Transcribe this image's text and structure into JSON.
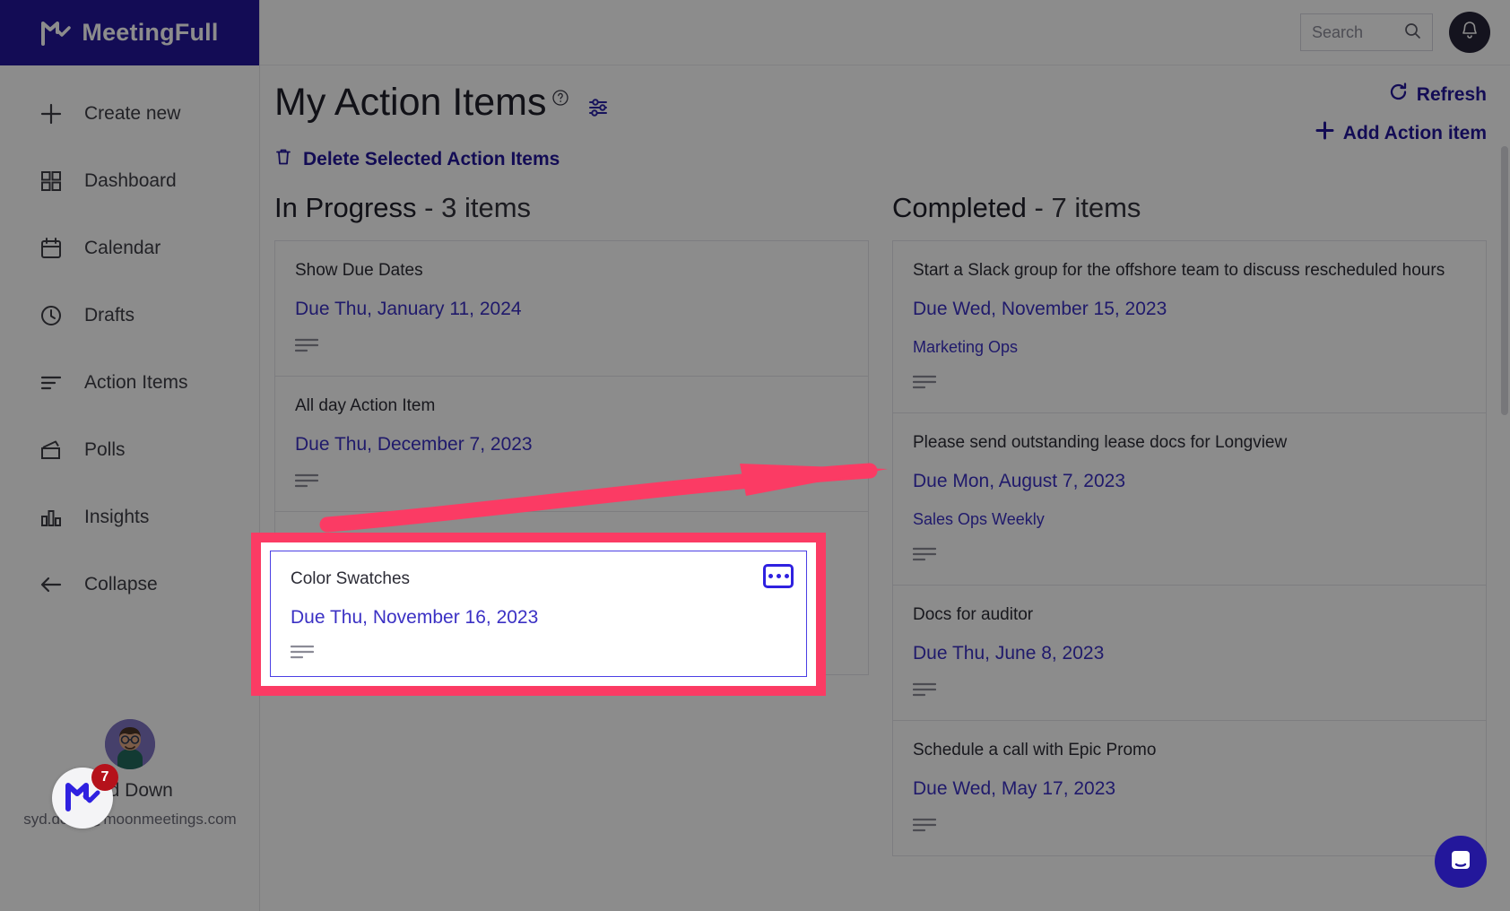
{
  "brand": {
    "name": "MeetingFull",
    "logo_icon": "meetingfull-logo-icon",
    "bg_color": "#23179b"
  },
  "sidebar": {
    "items": [
      {
        "label": "Create new",
        "icon": "plus-icon"
      },
      {
        "label": "Dashboard",
        "icon": "grid-icon"
      },
      {
        "label": "Calendar",
        "icon": "calendar-icon"
      },
      {
        "label": "Drafts",
        "icon": "clock-icon"
      },
      {
        "label": "Action Items",
        "icon": "list-lines-icon"
      },
      {
        "label": "Polls",
        "icon": "polls-icon"
      },
      {
        "label": "Insights",
        "icon": "bar-chart-icon"
      },
      {
        "label": "Collapse",
        "icon": "arrow-left-icon"
      }
    ],
    "user": {
      "name": "Syd Down",
      "email": "syd.down@moonmeetings.com",
      "avatar_icon": "user-avatar"
    }
  },
  "topbar": {
    "search": {
      "placeholder": "Search",
      "value": "",
      "icon": "search-icon"
    },
    "notifications_icon": "bell-icon"
  },
  "header": {
    "title": "My Action Items",
    "help_icon": "question-circle-icon",
    "filter_icon": "sliders-icon",
    "refresh_label": "Refresh",
    "refresh_icon": "refresh-icon",
    "add_label": "Add Action item",
    "add_icon": "plus-icon"
  },
  "toolbar": {
    "delete_label": "Delete Selected Action Items",
    "delete_icon": "trash-icon"
  },
  "columns": [
    {
      "name": "In Progress",
      "separator": "-",
      "count_label": "3 items",
      "cards": [
        {
          "title": "Show Due Dates",
          "due": "Due Thu, January 11, 2024",
          "meeting": "",
          "notes_icon": "notes-lines-icon"
        },
        {
          "title": "All day Action Item",
          "due": "Due Thu, December 7, 2023",
          "meeting": "",
          "notes_icon": "notes-lines-icon"
        }
      ]
    },
    {
      "name": "Completed",
      "separator": "-",
      "count_label": "7 items",
      "cards": [
        {
          "title": "Start a Slack group for the offshore team to discuss rescheduled hours",
          "due": "Due Wed, November 15, 2023",
          "meeting": "Marketing Ops",
          "notes_icon": "notes-lines-icon"
        },
        {
          "title": "Please send outstanding lease docs for Longview",
          "due": "Due Mon, August 7, 2023",
          "meeting": "Sales Ops Weekly",
          "notes_icon": "notes-lines-icon"
        },
        {
          "title": "Docs for auditor",
          "due": "Due Thu, June 8, 2023",
          "meeting": "",
          "notes_icon": "notes-lines-icon"
        },
        {
          "title": "Schedule a call with Epic Promo",
          "due": "Due Wed, May 17, 2023",
          "meeting": "",
          "notes_icon": "notes-lines-icon"
        }
      ]
    }
  ],
  "highlight": {
    "title": "Color Swatches",
    "due": "Due Thu, November 16, 2023",
    "menu_icon": "ellipsis-icon",
    "notes_icon": "notes-lines-icon",
    "outline_color": "#fb3b64",
    "card_border_color": "#4b3fe4"
  },
  "annotation": {
    "arrow_icon": "pink-arrow-icon",
    "color": "#fb3b64"
  },
  "mail_widget": {
    "count": "7",
    "icon": "mail-logo-icon"
  },
  "support": {
    "icon": "intercom-chat-icon"
  }
}
